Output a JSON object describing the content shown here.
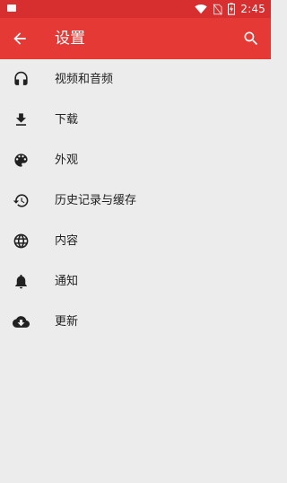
{
  "status_bar": {
    "time": "2:45",
    "colors": {
      "background": "#d72f2f",
      "foreground": "#ffffff"
    }
  },
  "app_bar": {
    "title": "设置",
    "back_icon": "arrow-back-icon",
    "search_icon": "search-icon",
    "color": "#e53935"
  },
  "settings": {
    "items": [
      {
        "label": "视频和音频",
        "icon": "headphones-icon"
      },
      {
        "label": "下载",
        "icon": "download-icon"
      },
      {
        "label": "外观",
        "icon": "palette-icon"
      },
      {
        "label": "历史记录与缓存",
        "icon": "history-icon"
      },
      {
        "label": "内容",
        "icon": "globe-icon"
      },
      {
        "label": "通知",
        "icon": "bell-icon"
      },
      {
        "label": "更新",
        "icon": "cloud-download-icon"
      }
    ]
  }
}
